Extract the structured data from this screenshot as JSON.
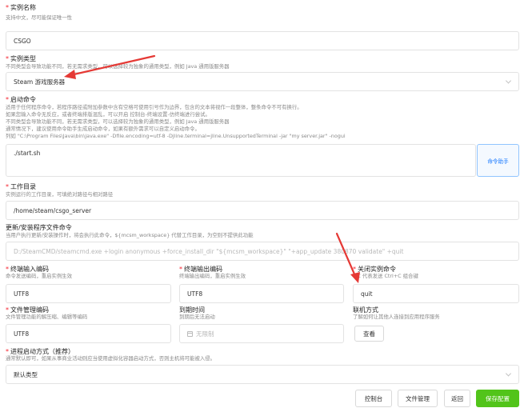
{
  "instance_name": {
    "label": "实例名称",
    "hint": "支持中文，尽可能保证唯一性",
    "value": "CSGO"
  },
  "instance_type": {
    "label": "实例类型",
    "hint": "不同类型会导致功能不同，若无需求类型，可以选择较为独象的通用类型，例如 Java 通用版服务器",
    "value": "Steam 游戏服务器"
  },
  "startup_command": {
    "label": "启动命令",
    "hints": [
      "适用于任何程序命令，若程序路径或附加参数中含有空格可使用引号作为边界，包含的文本将视作一段整体，整条命令不可有换行。",
      "如果您输入命令无反应，或者终端排版混乱，可以开启 控制台-终端设置-仿终端进行尝试。",
      "不同类型会导致功能不同，若无需求类型，可以选择较为独象的通用类型，例如 Java 通用版服务器",
      "通常情况下，建议使用命令助手生成启动命令，如果有额外需求可以自定义启动命令。",
      "列如 \"C:\\Program Files\\Java\\bin\\java.exe\" -Dfile.encoding=utf-8 -Djline.terminal=jline.UnsupportedTerminal -jar \"my server.jar\" -nogui"
    ],
    "value": "./start.sh",
    "helper_button": "命令助手"
  },
  "working_directory": {
    "label": "工作目录",
    "hint": "实例运行的工作目录，可填绝对路径与相对路径",
    "value": "/home/steam/csgo_server"
  },
  "update_command": {
    "label": "更新/安装程序文件命令",
    "hint": "当用户执行更新/安装操作时，将会执行此命令，${mcsm_workspace} 代替工作目录，为空则不提供此功能",
    "placeholder": "D:/SteamCMD/steamcmd.exe +login anonymous +force_install_dir \"${mcsm_workspace}\" \"+app_update 380870 validate\" +quit"
  },
  "input_encoding": {
    "label": "终端输入编码",
    "hint": "命令发送编码，重启实例生效",
    "value": "UTF8"
  },
  "output_encoding": {
    "label": "终端输出编码",
    "hint": "终端输出编码，重启实例生效",
    "value": "UTF8"
  },
  "stop_command": {
    "label": "关闭实例命令",
    "hint": "^C 代表发送 Ctrl+C 组合键",
    "value": "quit"
  },
  "file_encoding": {
    "label": "文件管理编码",
    "hint": "文件管理功能的解压缩、编辑等编码",
    "value": "UTF8"
  },
  "expire_time": {
    "label": "到期时间",
    "hint": "到期后无法启动",
    "placeholder": "无限制"
  },
  "contact": {
    "label": "联机方式",
    "hint": "了解如何让其他人连接到应用程序服务",
    "button": "查看"
  },
  "process_mode": {
    "label": "进程启动方式（推荐）",
    "hint": "通常默认即可，如果从事商业活动则应当使用虚拟化容器启动方式，否则主机将可能被入侵。",
    "value": "默认类型"
  },
  "footer": {
    "console": "控制台",
    "files": "文件管理",
    "back": "返回",
    "save": "保存配置"
  },
  "colors": {
    "required": "#f5222d",
    "save_button": "#52c41a",
    "annotation_arrow": "#e53935",
    "helper_button": "#1677ff"
  }
}
